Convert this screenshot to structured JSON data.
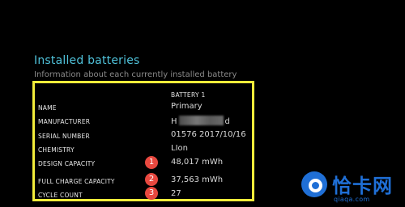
{
  "section": {
    "title": "Installed batteries",
    "subtitle": "Information about each currently installed battery"
  },
  "table": {
    "column_header": "BATTERY 1",
    "rows": [
      {
        "label": "NAME",
        "value": "Primary"
      },
      {
        "label": "MANUFACTURER",
        "value_prefix": "H",
        "value_suffix": "d"
      },
      {
        "label": "SERIAL NUMBER",
        "value": "01576 2017/10/16"
      },
      {
        "label": "CHEMISTRY",
        "value": "LIon"
      },
      {
        "label": "DESIGN CAPACITY",
        "value": "48,017 mWh",
        "marker": "1"
      },
      {
        "label": "FULL CHARGE CAPACITY",
        "value": "37,563 mWh",
        "marker": "2"
      },
      {
        "label": "CYCLE COUNT",
        "value": "27",
        "marker": "3"
      }
    ]
  },
  "colors": {
    "title": "#4fc1d9",
    "highlight_border": "#f2ec3a",
    "marker": "#e8483f",
    "watermark": "#1f6fd6"
  },
  "watermark": {
    "brand": "恰卡网",
    "url": "qiaqa.com"
  }
}
